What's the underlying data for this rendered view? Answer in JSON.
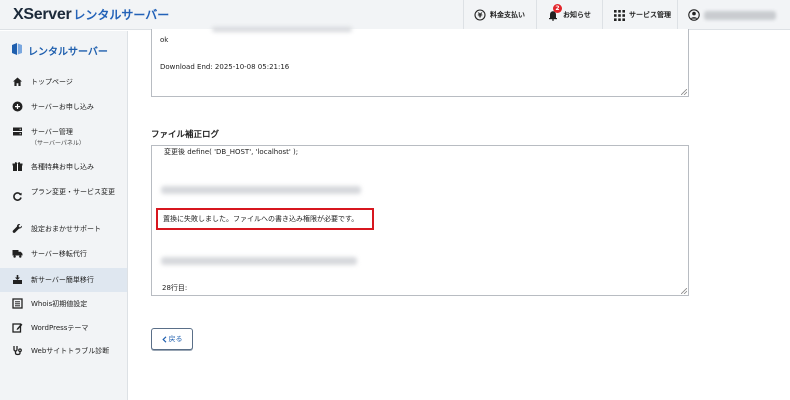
{
  "header": {
    "logo_main": "XServer",
    "logo_sub": "レンタルサーバー",
    "nav": {
      "billing": "料金支払い",
      "notifications": "お知らせ",
      "notification_count": "2",
      "services": "サービス管理"
    }
  },
  "sidebar": {
    "title": "レンタルサーバー",
    "items": [
      {
        "label": "トップページ",
        "icon": "home-icon"
      },
      {
        "label": "サーバーお申し込み",
        "icon": "plus-circle-icon"
      },
      {
        "label": "サーバー管理",
        "sub": "（サーバーパネル）",
        "icon": "server-icon"
      },
      {
        "label": "各種特典お申し込み",
        "icon": "gift-icon"
      },
      {
        "label": "プラン変更・サービス変更",
        "icon": "refresh-icon"
      },
      {
        "label": "設定おまかせサポート",
        "icon": "wrench-icon"
      },
      {
        "label": "サーバー移転代行",
        "icon": "truck-icon"
      },
      {
        "label": "新サーバー簡単移行",
        "icon": "migrate-icon",
        "active": true
      },
      {
        "label": "Whois初期値設定",
        "icon": "list-icon"
      },
      {
        "label": "WordPressテーマ",
        "icon": "edit-icon"
      },
      {
        "label": "Webサイトトラブル診断",
        "icon": "stethoscope-icon"
      }
    ]
  },
  "main": {
    "download_log": {
      "line_ok": "ok",
      "line_end": "Download End: 2025-10-08 05:21:16"
    },
    "fix_log_title": "ファイル補正ログ",
    "fix_log": {
      "line_changed": "変更後 define( 'DB_HOST', 'localhost' );",
      "line_error": "置換に失敗しました。ファイルへの書き込み権限が必要です。",
      "line_row": "28行目:"
    },
    "back_button": "戻る"
  },
  "colors": {
    "brand_blue": "#1f5fae",
    "highlight_red": "#d7171f",
    "badge_red": "#e2252b"
  }
}
